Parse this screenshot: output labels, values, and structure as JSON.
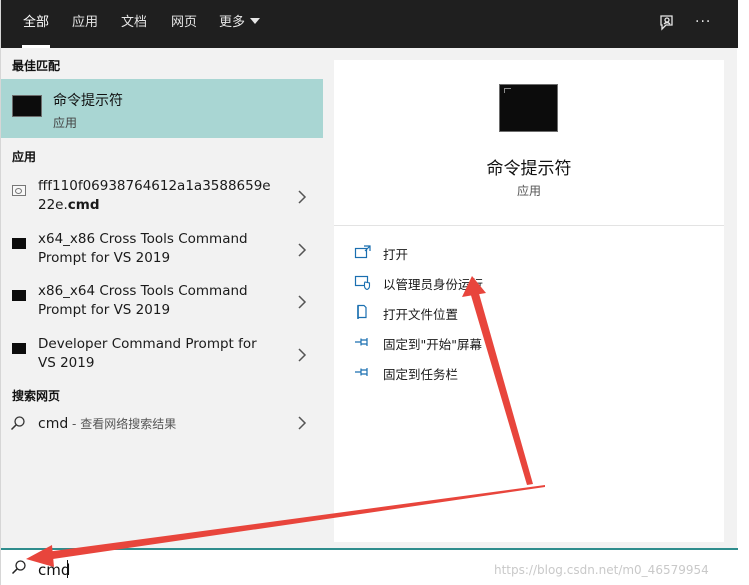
{
  "header": {
    "tabs": [
      {
        "label": "全部",
        "active": true
      },
      {
        "label": "应用"
      },
      {
        "label": "文档"
      },
      {
        "label": "网页"
      },
      {
        "label": "更多"
      }
    ],
    "icons": [
      "feedback-icon",
      "more-options-icon"
    ],
    "more_options": "···"
  },
  "left": {
    "best_match_heading": "最佳匹配",
    "best_match": {
      "name": "命令提示符",
      "type": "应用"
    },
    "apps_heading": "应用",
    "apps": [
      {
        "line1": "fff110f06938764612a1a3588659e",
        "line2_prefix": "22e.",
        "line2_bold": "cmd"
      },
      {
        "line1": "x64_x86 Cross Tools Command",
        "line2": "Prompt for VS 2019"
      },
      {
        "line1": "x86_x64 Cross Tools Command",
        "line2": "Prompt for VS 2019"
      },
      {
        "line1": "Developer Command Prompt for",
        "line2": "VS 2019"
      }
    ],
    "web_heading": "搜索网页",
    "web_query": "cmd",
    "web_hint": " - 查看网络搜索结果"
  },
  "right": {
    "title": "命令提示符",
    "type": "应用",
    "actions": [
      {
        "label": "打开",
        "icon": "open-icon"
      },
      {
        "label": "以管理员身份运行",
        "icon": "run-as-admin-icon"
      },
      {
        "label": "打开文件位置",
        "icon": "file-location-icon"
      },
      {
        "label": "固定到\"开始\"屏幕",
        "icon": "pin-icon"
      },
      {
        "label": "固定到任务栏",
        "icon": "pin-icon"
      }
    ]
  },
  "search": {
    "value": "cmd"
  },
  "watermark": "https://blog.csdn.net/m0_46579954",
  "colors": {
    "accent": "#2f8d8d",
    "selection": "#a9d6d3",
    "topbar": "#1f1f1f",
    "action_icon": "#1a6fb0",
    "arrow": "#e8453c"
  }
}
